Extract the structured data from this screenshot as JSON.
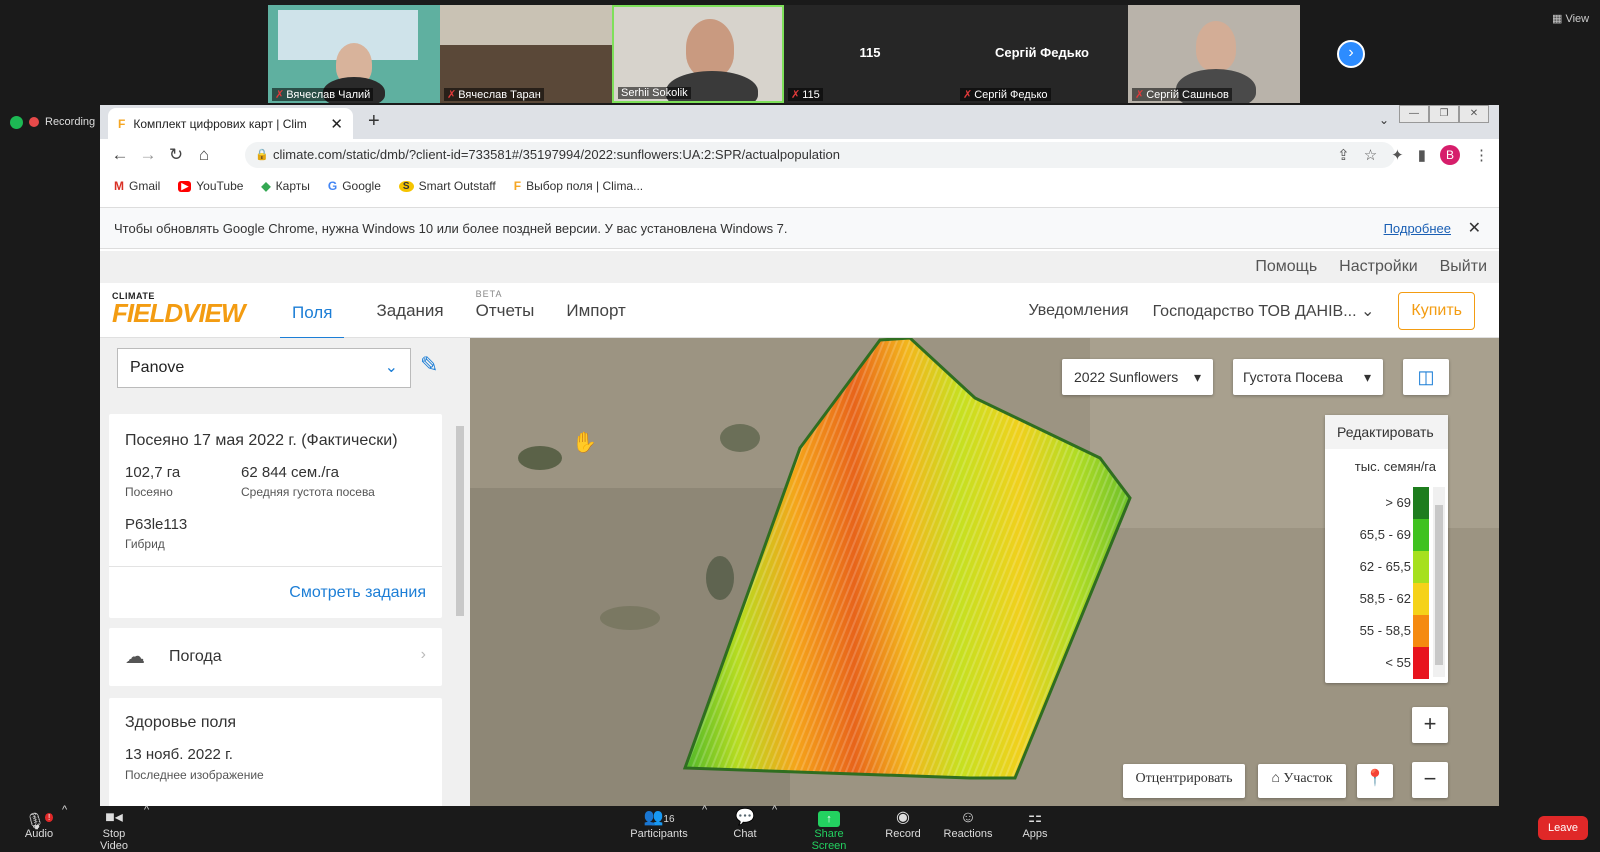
{
  "zoom": {
    "participants": [
      {
        "name": "Вячеслав Чалий",
        "muted": true
      },
      {
        "name": "Вячеслав Таран",
        "muted": true
      },
      {
        "name": "Serhii Sokolik",
        "muted": false
      },
      {
        "name": "115",
        "muted": true,
        "display": "115"
      },
      {
        "name": "Сергій Федько",
        "muted": true,
        "display": "Сергій Федько"
      },
      {
        "name": "Сергій Сашньов",
        "muted": true
      }
    ],
    "view_label": "View",
    "recording_label": "Recording",
    "toolbar": {
      "audio": "Audio",
      "stop_video": "Stop Video",
      "participants": "Participants",
      "participants_count": "16",
      "chat": "Chat",
      "share_screen": "Share Screen",
      "record": "Record",
      "reactions": "Reactions",
      "apps": "Apps",
      "leave": "Leave",
      "audio_badge": "!"
    }
  },
  "browser": {
    "tab_title": "Комплект цифрових карт | Clim",
    "url": "climate.com/static/dmb/?client-id=733581#/35197994/2022:sunflowers:UA:2:SPR/actualpopulation",
    "avatar_letter": "B",
    "bookmarks": [
      "Gmail",
      "YouTube",
      "Карты",
      "Google",
      "Smart Outstaff",
      "Выбор поля | Clima..."
    ],
    "infobar_text": "Чтобы обновлять Google Chrome, нужна Windows 10 или более поздней версии. У вас установлена Windows 7.",
    "infobar_link": "Подробнее"
  },
  "fieldview": {
    "top_links": [
      "Помощь",
      "Настройки",
      "Выйти"
    ],
    "logo_small": "CLIMATE",
    "logo_big": "FIELDVIEW",
    "nav": {
      "fields": "Поля",
      "tasks": "Задания",
      "beta": "BETA",
      "reports": "Отчеты",
      "import": "Импорт"
    },
    "notifications": "Уведомления",
    "farm": "Господарство ТОВ ДАНІВ...",
    "buy": "Купить",
    "field_select": "Panove",
    "planting": {
      "title": "Посеяно 17 мая 2022 г. (Фактически)",
      "area_value": "102,7 га",
      "area_label": "Посеяно",
      "density_value": "62 844 сем./га",
      "density_label": "Средняя густота посева",
      "hybrid_value": "P63le113",
      "hybrid_label": "Гибрид",
      "view_tasks": "Смотреть задания"
    },
    "weather": "Погода",
    "health": {
      "title": "Здоровье поля",
      "date": "13 нояб. 2022 г.",
      "label": "Последнее изображение"
    },
    "map": {
      "season_select": "2022 Sunflowers",
      "layer_select": "Густота Посева",
      "edit": "Редактировать",
      "unit": "тыс. семян/га",
      "legend": [
        {
          "label": "> 69",
          "color": "#1e7d1e"
        },
        {
          "label": "65,5 - 69",
          "color": "#3fc21f"
        },
        {
          "label": "62 - 65,5",
          "color": "#a6e01e"
        },
        {
          "label": "58,5 - 62",
          "color": "#f5d219"
        },
        {
          "label": "55 - 58,5",
          "color": "#f58a10"
        },
        {
          "label": "< 55",
          "color": "#e8141e"
        }
      ],
      "center_btn": "Отцентрировать",
      "plot_btn": "Участок"
    }
  }
}
